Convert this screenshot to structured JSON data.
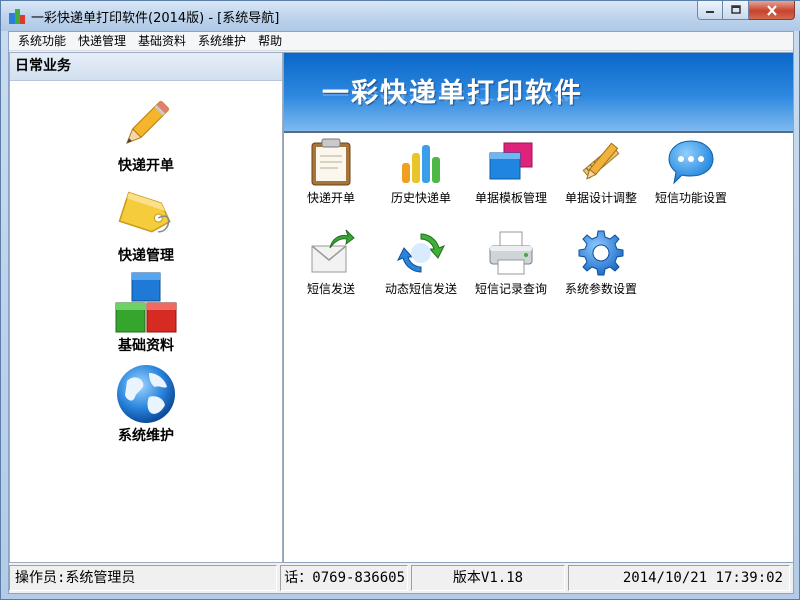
{
  "window": {
    "title": "一彩快递单打印软件(2014版) - [系统导航]",
    "minimize_label": "minimize",
    "maximize_label": "maximize",
    "close_label": "close"
  },
  "menu": {
    "items": [
      {
        "label": "系统功能"
      },
      {
        "label": "快递管理"
      },
      {
        "label": "基础资料"
      },
      {
        "label": "系统维护"
      },
      {
        "label": "帮助"
      }
    ]
  },
  "left_panel": {
    "header": "日常业务",
    "items": [
      {
        "label": "快递开单",
        "icon": "pencil-icon"
      },
      {
        "label": "快递管理",
        "icon": "tag-icon"
      },
      {
        "label": "基础资料",
        "icon": "blocks-icon"
      },
      {
        "label": "系统维护",
        "icon": "globe-icon"
      }
    ]
  },
  "banner": {
    "title": "一彩快递单打印软件"
  },
  "tiles": [
    {
      "label": "快递开单",
      "icon": "clipboard-icon"
    },
    {
      "label": "历史快递单",
      "icon": "bar-chart-icon"
    },
    {
      "label": "单据模板管理",
      "icon": "template-icon"
    },
    {
      "label": "单据设计调整",
      "icon": "ruler-pencil-icon"
    },
    {
      "label": "短信功能设置",
      "icon": "chat-bubble-icon"
    },
    {
      "label": "短信发送",
      "icon": "envelope-send-icon"
    },
    {
      "label": "动态短信发送",
      "icon": "refresh-icon"
    },
    {
      "label": "短信记录查询",
      "icon": "printer-icon"
    },
    {
      "label": "系统参数设置",
      "icon": "gear-icon"
    }
  ],
  "status": {
    "operator": "操作员:系统管理员",
    "phone": "话：0769-836605",
    "version": "版本V1.18",
    "datetime": "2014/10/21 17:39:02"
  },
  "colors": {
    "banner_top": "#0a67c9",
    "banner_bottom": "#7fbaf0",
    "title_bar": "#c1d6ee",
    "close_button": "#c7432c"
  }
}
